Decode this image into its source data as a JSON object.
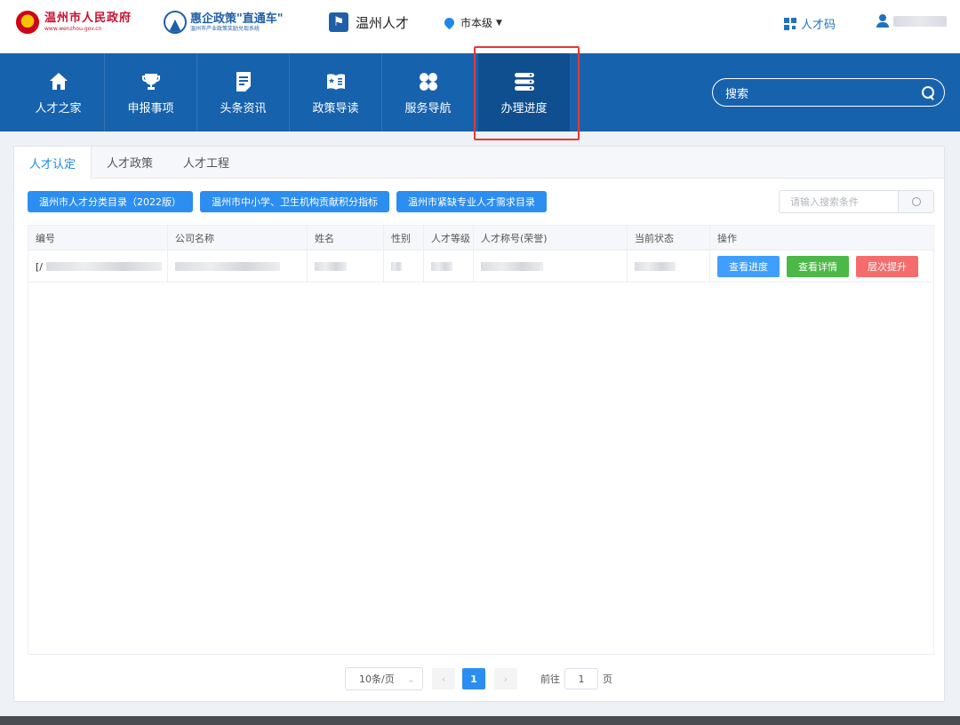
{
  "header": {
    "gov_name": "温州市人民政府",
    "gov_url": "www.wenzhou.gov.cn",
    "policy_name": "惠企政策\"直通车\"",
    "policy_sub": "温州市产业政策奖励兑现系统",
    "talent_name": "温州人才",
    "region": "市本级",
    "talent_code": "人才码"
  },
  "nav": {
    "items": [
      {
        "label": "人才之家",
        "icon": "home-icon"
      },
      {
        "label": "申报事项",
        "icon": "trophy-icon"
      },
      {
        "label": "头条资讯",
        "icon": "document-icon"
      },
      {
        "label": "政策导读",
        "icon": "book-icon"
      },
      {
        "label": "服务导航",
        "icon": "grid-icon"
      },
      {
        "label": "办理进度",
        "icon": "stack-icon"
      }
    ],
    "active_index": 5,
    "search_label": "搜索"
  },
  "tabs": [
    "人才认定",
    "人才政策",
    "人才工程"
  ],
  "category_buttons": [
    "温州市人才分类目录（2022版）",
    "温州市中小学、卫生机构贡献积分指标",
    "温州市紧缺专业人才需求目录"
  ],
  "filter": {
    "placeholder": "请输入搜索条件"
  },
  "table": {
    "headers": [
      "编号",
      "公司名称",
      "姓名",
      "性别",
      "人才等级",
      "人才称号(荣誉)",
      "当前状态",
      "操作"
    ],
    "row": {
      "id_prefix": "[/",
      "actions": [
        "查看进度",
        "查看详情",
        "层次提升"
      ]
    }
  },
  "pager": {
    "page_size": "10条/页",
    "current_page": "1",
    "goto_label": "前往",
    "goto_value": "1",
    "page_unit": "页"
  },
  "colors": {
    "nav_bg": "#1762ad",
    "primary": "#2b8ef0",
    "green": "#4cb848",
    "red": "#f56c6c",
    "highlight": "#e53935"
  }
}
